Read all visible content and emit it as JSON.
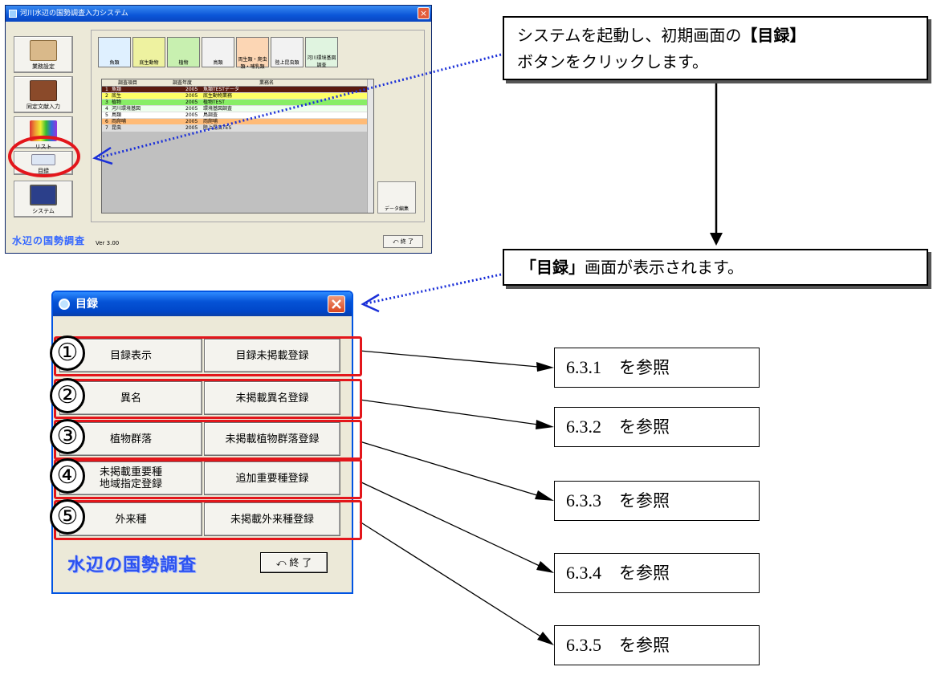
{
  "main_window": {
    "title": "河川水辺の国勢調査入力システム",
    "side_buttons": [
      "業務設定",
      "同定文献入力",
      "リスト",
      "目録",
      "システム"
    ],
    "categories": [
      "魚類",
      "底生動物",
      "植物",
      "鳥類",
      "両生類・爬虫類・哺乳類",
      "陸上昆虫類",
      "河川環境基図調査"
    ],
    "grid_headers": [
      "調査項目",
      "調査年度",
      "業務名"
    ],
    "grid_rows": [
      {
        "no": "1",
        "item": "魚類",
        "year": "2005",
        "name": "魚類TESTデータ",
        "color": "#5a1a10"
      },
      {
        "no": "2",
        "item": "底生",
        "year": "2005",
        "name": "底生動物業務",
        "color": "#ffff66"
      },
      {
        "no": "3",
        "item": "植物",
        "year": "2005",
        "name": "植物TEST",
        "color": "#88ee66"
      },
      {
        "no": "4",
        "item": "河川環境基図",
        "year": "2005",
        "name": "環境基図調査",
        "color": "#eeffee"
      },
      {
        "no": "5",
        "item": "鳥類",
        "year": "2005",
        "name": "鳥調査",
        "color": "#ffffff"
      },
      {
        "no": "6",
        "item": "両爬哺",
        "year": "2005",
        "name": "両爬哺",
        "color": "#ffbb77"
      },
      {
        "no": "7",
        "item": "昆虫",
        "year": "2005",
        "name": "陸上昆虫TES",
        "color": "#dddddd"
      }
    ],
    "data_edit_label": "データ編集",
    "logo": "水辺の国勢調査",
    "version": "Ver 3.00",
    "exit_label": "終 了"
  },
  "callout1": {
    "line1_pre": "システムを起動し、初期画面の",
    "line1_bold": "【目録】",
    "line2": "ボタンをクリックします。"
  },
  "callout2": {
    "bold": "「目録」",
    "rest": "画面が表示されます。"
  },
  "dialog": {
    "title": "目録",
    "rows": [
      {
        "num": "①",
        "left": "目録表示",
        "right": "目録未掲載登録"
      },
      {
        "num": "②",
        "left": "異名",
        "right": "未掲載異名登録"
      },
      {
        "num": "③",
        "left": "植物群落",
        "right": "未掲載植物群落登録"
      },
      {
        "num": "④",
        "left": "未掲載重要種\n地域指定登録",
        "right": "追加重要種登録"
      },
      {
        "num": "⑤",
        "left": "外来種",
        "right": "未掲載外来種登録"
      }
    ],
    "logo": "水辺の国勢調査",
    "exit_label": "終 了"
  },
  "references": [
    {
      "num": "6.3.1",
      "text": "を参照"
    },
    {
      "num": "6.3.2",
      "text": "を参照"
    },
    {
      "num": "6.3.3",
      "text": "を参照"
    },
    {
      "num": "6.3.4",
      "text": "を参照"
    },
    {
      "num": "6.3.5",
      "text": "を参照"
    }
  ],
  "colors": {
    "highlight_red": "#e3161b",
    "arrow_blue": "#1a2fd8",
    "xp_blue": "#0054e3"
  }
}
